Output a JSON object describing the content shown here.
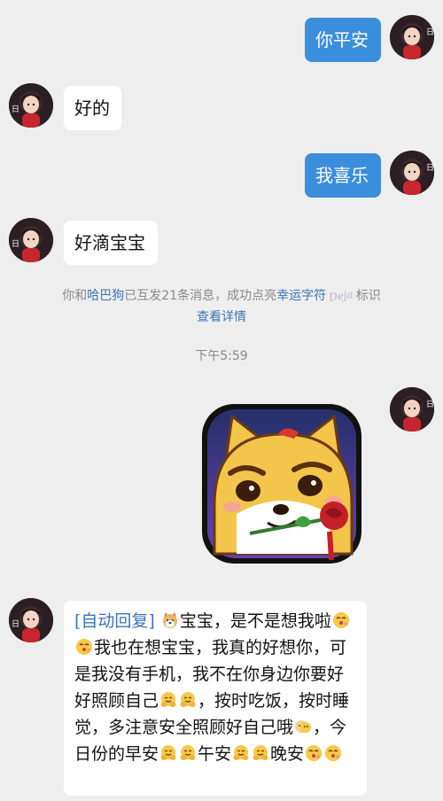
{
  "messages": {
    "m1_text": "你平安",
    "m2_text": "好的",
    "m3_text": "我喜乐",
    "m4_text": "好滴宝宝"
  },
  "system_notice": {
    "prefix": "你和",
    "friend_name": "哈巴狗",
    "middle": "已互发21条消息，成功点亮",
    "badge": "幸运字符",
    "badge_logo_text": "Deja",
    "suffix": "标识",
    "details_link": "查看详情"
  },
  "timestamp": "下午5:59",
  "auto_reply": {
    "tag": "[自动回复]",
    "segments": [
      {
        "type": "emoji",
        "name": "dog-face-emoji"
      },
      {
        "type": "text",
        "text": "宝宝，是不是想我啦"
      },
      {
        "type": "emoji",
        "name": "kissing-face-emoji"
      },
      {
        "type": "emoji",
        "name": "kissing-face-emoji"
      },
      {
        "type": "text",
        "text": "我也在想宝宝，我真的好想你，可是我没有手机，我不在你身边你要好好照顾自己"
      },
      {
        "type": "emoji",
        "name": "hugging-face-emoji"
      },
      {
        "type": "emoji",
        "name": "hugging-face-emoji"
      },
      {
        "type": "text",
        "text": "，按时吃饭，按时睡觉，多注意安全照顾好自己哦"
      },
      {
        "type": "emoji",
        "name": "hug-emoji"
      },
      {
        "type": "text",
        "text": "，今日份的早安"
      },
      {
        "type": "emoji",
        "name": "hugging-face-emoji"
      },
      {
        "type": "emoji",
        "name": "hugging-face-emoji"
      },
      {
        "type": "text",
        "text": "午安"
      },
      {
        "type": "emoji",
        "name": "hugging-face-emoji"
      },
      {
        "type": "emoji",
        "name": "hugging-face-emoji"
      },
      {
        "type": "text",
        "text": "晚安"
      },
      {
        "type": "emoji",
        "name": "kissing-face-emoji"
      },
      {
        "type": "emoji",
        "name": "kissing-face-emoji"
      }
    ]
  },
  "colors": {
    "outgoing_bubble": "#3b8edb",
    "incoming_bubble": "#ffffff",
    "link": "#3b74b8",
    "background": "#eeeeee"
  },
  "sticker": {
    "name": "shiba-rose-sticker"
  }
}
